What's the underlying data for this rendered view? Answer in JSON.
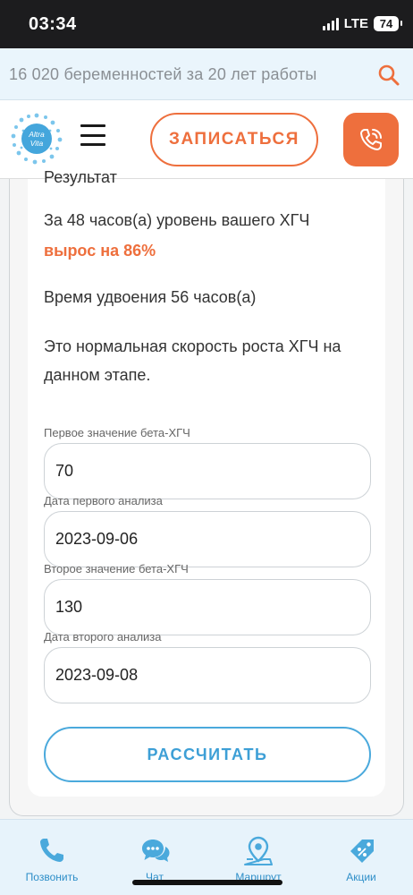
{
  "status_bar": {
    "time": "03:34",
    "network": "LTE",
    "battery": "74"
  },
  "search": {
    "placeholder_text": "16 020 беременностей за 20 лет работы",
    "icon": "search-icon"
  },
  "header": {
    "logo_text_top": "Altra",
    "logo_text_bottom": "Vita",
    "signup_label": "ЗАПИСАТЬСЯ",
    "menu_icon": "hamburger-menu-icon",
    "call_icon": "phone-icon"
  },
  "result": {
    "clipped_text": "Результат",
    "line1": "За 48 часов(а) уровень вашего ХГЧ",
    "growth": "вырос на 86%",
    "doubling": "Время удвоения 56 часов(а)",
    "conclusion": "Это нормальная скорость роста ХГЧ на данном этапе."
  },
  "form": {
    "fields": [
      {
        "label": "Первое значение бета-ХГЧ",
        "value": "70"
      },
      {
        "label": "Дата первого анализа",
        "value": "2023-09-06"
      },
      {
        "label": "Второе значение бета-ХГЧ",
        "value": "130"
      },
      {
        "label": "Дата второго анализа",
        "value": "2023-09-08"
      }
    ],
    "submit_label": "РАССЧИТАТЬ"
  },
  "bottom_nav": {
    "items": [
      {
        "label": "Позвонить",
        "icon": "phone-icon"
      },
      {
        "label": "Чат",
        "icon": "chat-icon"
      },
      {
        "label": "Маршрут",
        "icon": "map-pin-icon"
      },
      {
        "label": "Акции",
        "icon": "discount-tag-icon"
      }
    ]
  },
  "colors": {
    "accent_orange": "#ee6f3d",
    "accent_blue": "#3d9fd6",
    "nav_bg": "#e7f3fb"
  }
}
